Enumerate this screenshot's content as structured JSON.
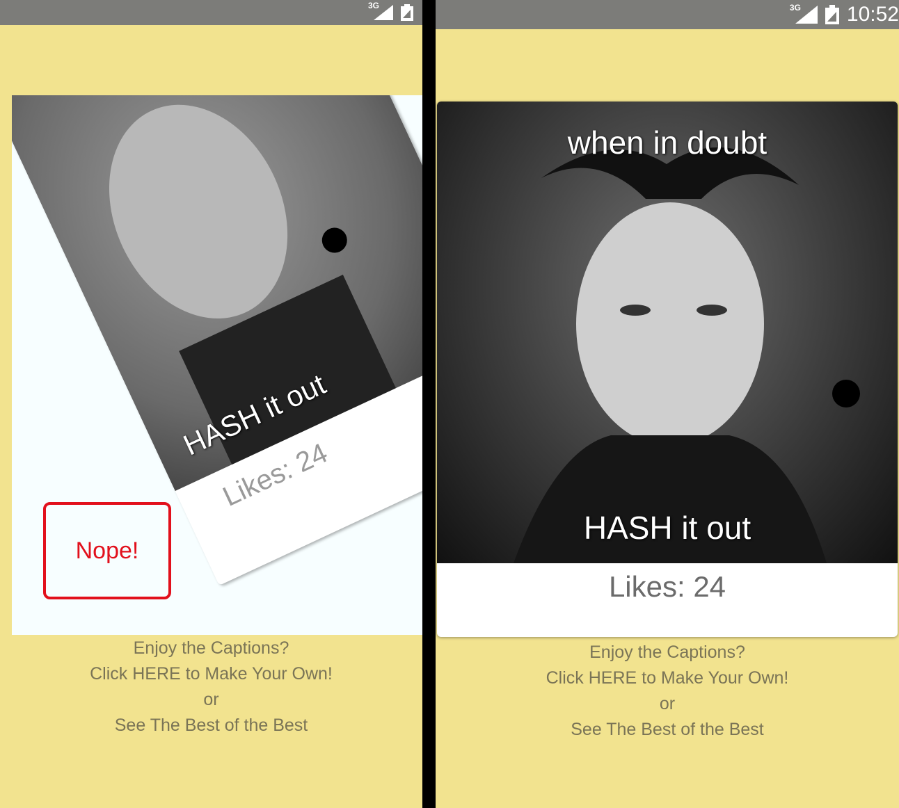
{
  "status_bar": {
    "network": "3G",
    "time": "10:52",
    "icons": [
      "signal-icon",
      "battery-icon"
    ]
  },
  "card": {
    "top_caption": "when in doubt",
    "bottom_caption": "HASH it out",
    "likes": "Likes: 24"
  },
  "swipe_stamp": "Nope!",
  "footer": {
    "line1": "Enjoy the Captions?",
    "make_own_link": "Click HERE to Make Your Own!",
    "or": "or",
    "best_link": "See The Best of the Best"
  },
  "colors": {
    "background": "#f2e38f",
    "status_bar": "#7c7c79",
    "nope": "#e2101c",
    "footer_text": "#7a7456"
  }
}
